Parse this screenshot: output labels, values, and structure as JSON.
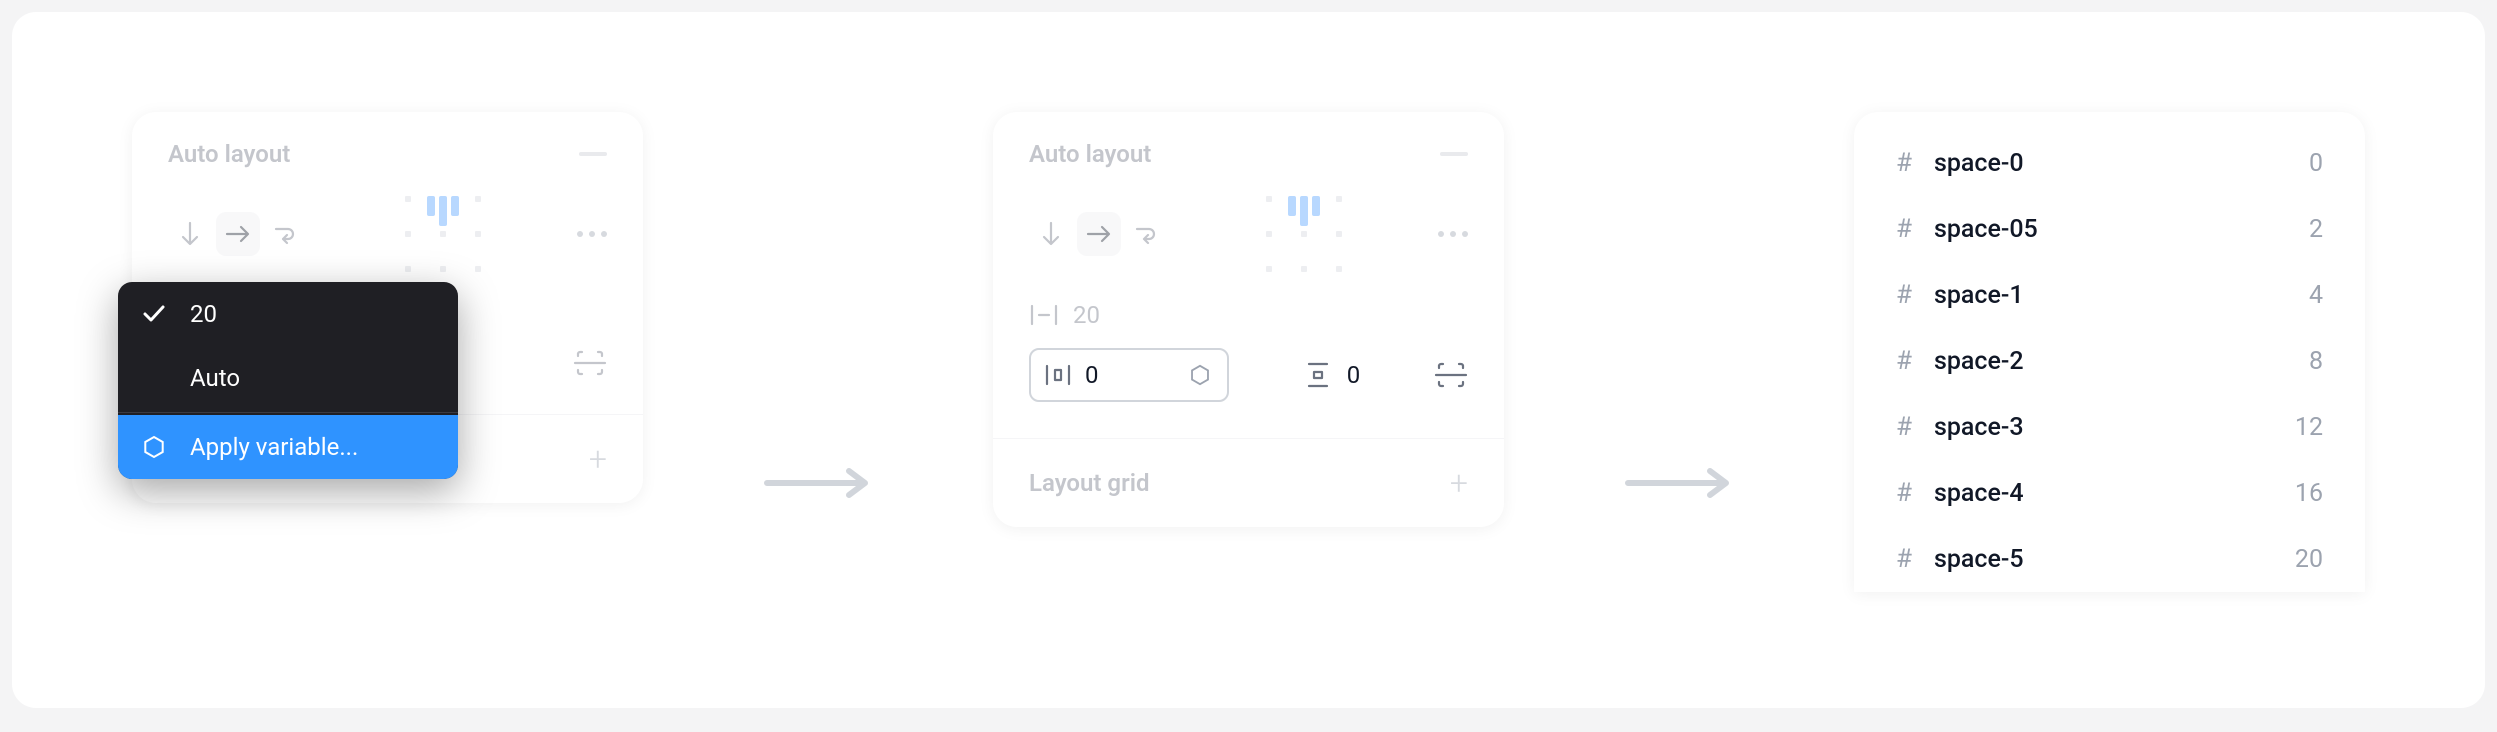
{
  "panels": {
    "p1": {
      "title": "Auto layout",
      "spacing_value": "20",
      "layout_grid_label": "Layout grid"
    },
    "p2": {
      "title": "Auto layout",
      "spacing_value": "20",
      "h_pad": "0",
      "v_pad": "0",
      "layout_grid_label": "Layout grid"
    }
  },
  "dropdown": {
    "opt_20": "20",
    "opt_auto": "Auto",
    "apply_variable": "Apply variable..."
  },
  "variables": [
    {
      "name": "space-0",
      "value": "0"
    },
    {
      "name": "space-05",
      "value": "2"
    },
    {
      "name": "space-1",
      "value": "4"
    },
    {
      "name": "space-2",
      "value": "8"
    },
    {
      "name": "space-3",
      "value": "12"
    },
    {
      "name": "space-4",
      "value": "16"
    },
    {
      "name": "space-5",
      "value": "20"
    }
  ]
}
